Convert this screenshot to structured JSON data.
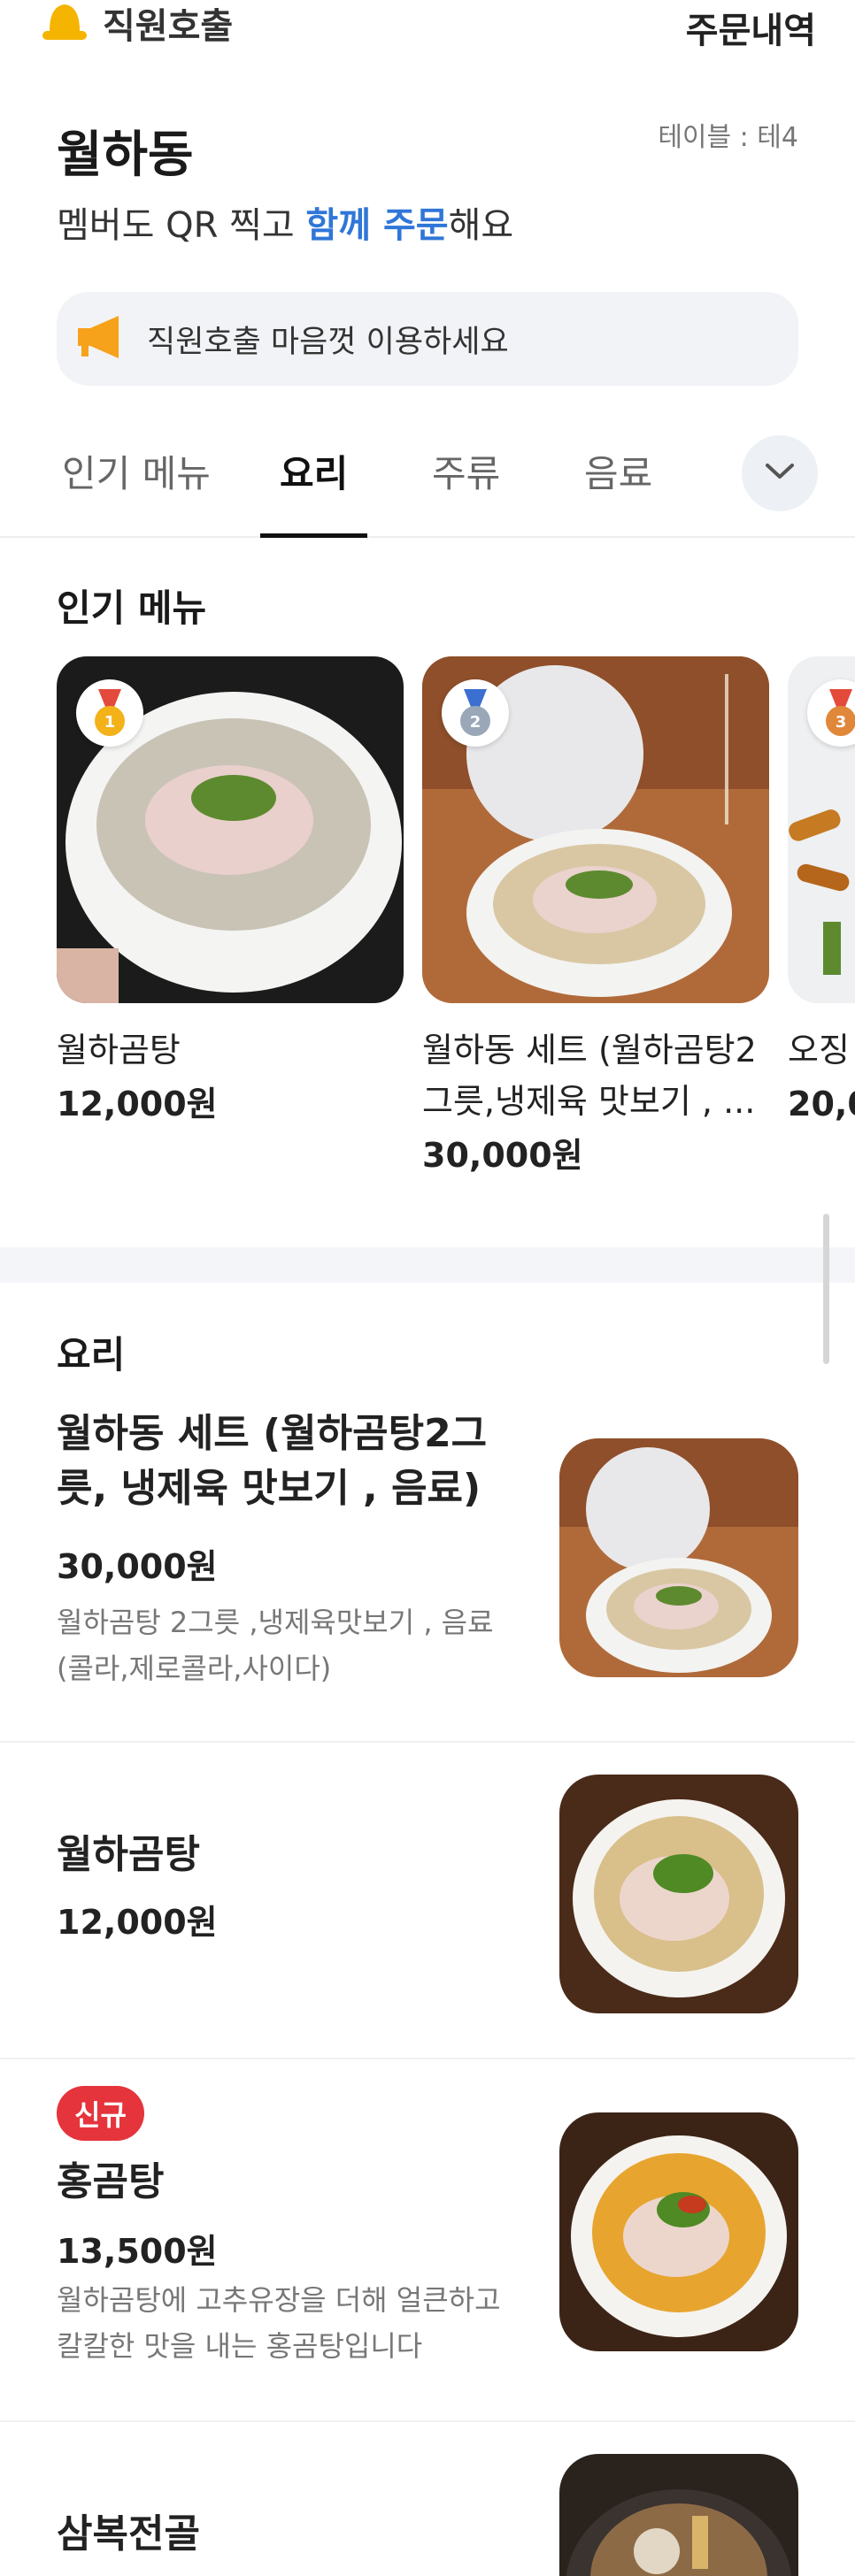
{
  "header": {
    "staff_call": "직원호출",
    "order_history": "주문내역"
  },
  "store": {
    "name": "월하동",
    "table": "테이블 : 테4",
    "subtitle_prefix": "멤버도 QR 찍고 ",
    "subtitle_highlight": "함께 주문",
    "subtitle_suffix": "해요",
    "notice": "직원호출 마음껏 이용하세요"
  },
  "tabs": [
    {
      "label": "인기 메뉴",
      "active": false
    },
    {
      "label": "요리",
      "active": true
    },
    {
      "label": "주류",
      "active": false
    },
    {
      "label": "음료",
      "active": false
    }
  ],
  "popular": {
    "title": "인기 메뉴",
    "items": [
      {
        "rank": "1",
        "name": "월하곰탕",
        "price": "12,000원"
      },
      {
        "rank": "2",
        "name": "월하동 세트 (월하곰탕2그릇,냉제육 맛보기 , ...",
        "price": "30,000원"
      },
      {
        "rank": "3",
        "name": "오징",
        "price": "20,0"
      }
    ]
  },
  "menu": {
    "title": "요리",
    "items": [
      {
        "name": "월하동 세트 (월하곰탕2그릇, 냉제육 맛보기 , 음료)",
        "price": "30,000원",
        "desc": "월하곰탕 2그릇 ,냉제육맛보기 , 음료 (콜라,제로콜라,사이다)",
        "badge": ""
      },
      {
        "name": "월하곰탕",
        "price": "12,000원",
        "desc": "",
        "badge": ""
      },
      {
        "name": "홍곰탕",
        "price": "13,500원",
        "desc": "월하곰탕에 고추유장을 더해 얼큰하고 칼칼한 맛을 내는 홍곰탕입니다",
        "badge": "신규"
      },
      {
        "name": "삼복전골",
        "price": "",
        "desc": "",
        "badge": ""
      }
    ]
  },
  "colors": {
    "accent_blue": "#2f76d8",
    "badge_red": "#e5343c",
    "bell_yellow": "#f5b400",
    "megaphone_orange": "#f7a21b"
  }
}
